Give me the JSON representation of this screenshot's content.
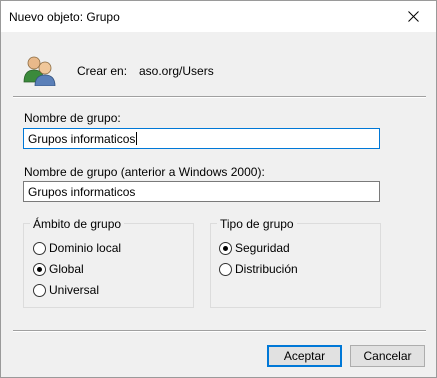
{
  "window": {
    "title": "Nuevo objeto: Grupo"
  },
  "header": {
    "create_in_label": "Crear en:",
    "create_in_value": "aso.org/Users",
    "icon": "group-users-icon"
  },
  "form": {
    "group_name_label": "Nombre de grupo:",
    "group_name_value": "Grupos informaticos",
    "group_name_pre2000_label": "Nombre de grupo (anterior a Windows 2000):",
    "group_name_pre2000_value": "Grupos informaticos"
  },
  "scope": {
    "title": "Ámbito de grupo",
    "options": [
      {
        "label": "Dominio local",
        "checked": false
      },
      {
        "label": "Global",
        "checked": true
      },
      {
        "label": "Universal",
        "checked": false
      }
    ]
  },
  "type": {
    "title": "Tipo de grupo",
    "options": [
      {
        "label": "Seguridad",
        "checked": true
      },
      {
        "label": "Distribución",
        "checked": false
      }
    ]
  },
  "buttons": {
    "accept": "Aceptar",
    "cancel": "Cancelar"
  },
  "colors": {
    "accent": "#0078d7",
    "background": "#f0f0f0"
  }
}
